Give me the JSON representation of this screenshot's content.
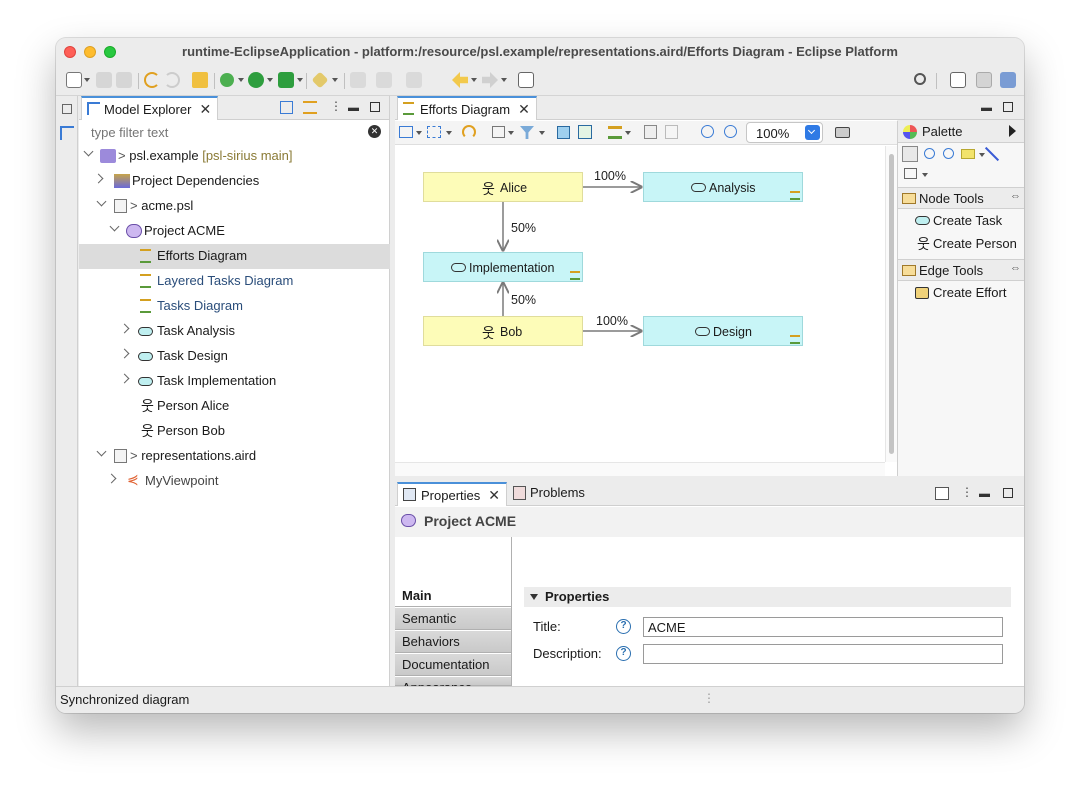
{
  "window": {
    "title": "runtime-EclipseApplication - platform:/resource/psl.example/representations.aird/Efforts Diagram - Eclipse Platform"
  },
  "model_explorer": {
    "tab_label": "Model Explorer",
    "filter_placeholder": "type filter text",
    "tree": [
      {
        "label": "psl.example",
        "suffix": "[psl-sirius main]",
        "prefix": ">"
      },
      {
        "label": "Project Dependencies"
      },
      {
        "label": "acme.psl",
        "prefix": ">"
      },
      {
        "label": "Project ACME"
      },
      {
        "label": "Efforts Diagram"
      },
      {
        "label": "Layered Tasks Diagram"
      },
      {
        "label": "Tasks Diagram"
      },
      {
        "label": "Task Analysis"
      },
      {
        "label": "Task Design"
      },
      {
        "label": "Task Implementation"
      },
      {
        "label": "Person Alice"
      },
      {
        "label": "Person Bob"
      },
      {
        "label": "representations.aird",
        "prefix": ">"
      },
      {
        "label": "MyViewpoint"
      }
    ]
  },
  "editor": {
    "tab_label": "Efforts Diagram",
    "zoom": "100%",
    "nodes": {
      "alice": "Alice",
      "analysis": "Analysis",
      "implementation": "Implementation",
      "bob": "Bob",
      "design": "Design"
    },
    "edges": {
      "alice_analysis": "100%",
      "alice_implementation": "50%",
      "bob_implementation": "50%",
      "bob_design": "100%"
    }
  },
  "palette": {
    "title": "Palette",
    "node_tools": "Node Tools",
    "create_task": "Create Task",
    "create_person": "Create Person",
    "edge_tools": "Edge Tools",
    "create_effort": "Create Effort"
  },
  "properties": {
    "tab_label": "Properties",
    "problems_label": "Problems",
    "header": "Project ACME",
    "section": "Properties",
    "tabs": [
      "Main",
      "Semantic",
      "Behaviors",
      "Documentation",
      "Appearance"
    ],
    "title_label": "Title:",
    "title_value": "ACME",
    "description_label": "Description:",
    "description_value": ""
  },
  "status": {
    "text": "Synchronized diagram"
  },
  "colors": {
    "person_node": "#fdfcb8",
    "task_node": "#c8f5f7",
    "accent": "#4a90d9"
  }
}
